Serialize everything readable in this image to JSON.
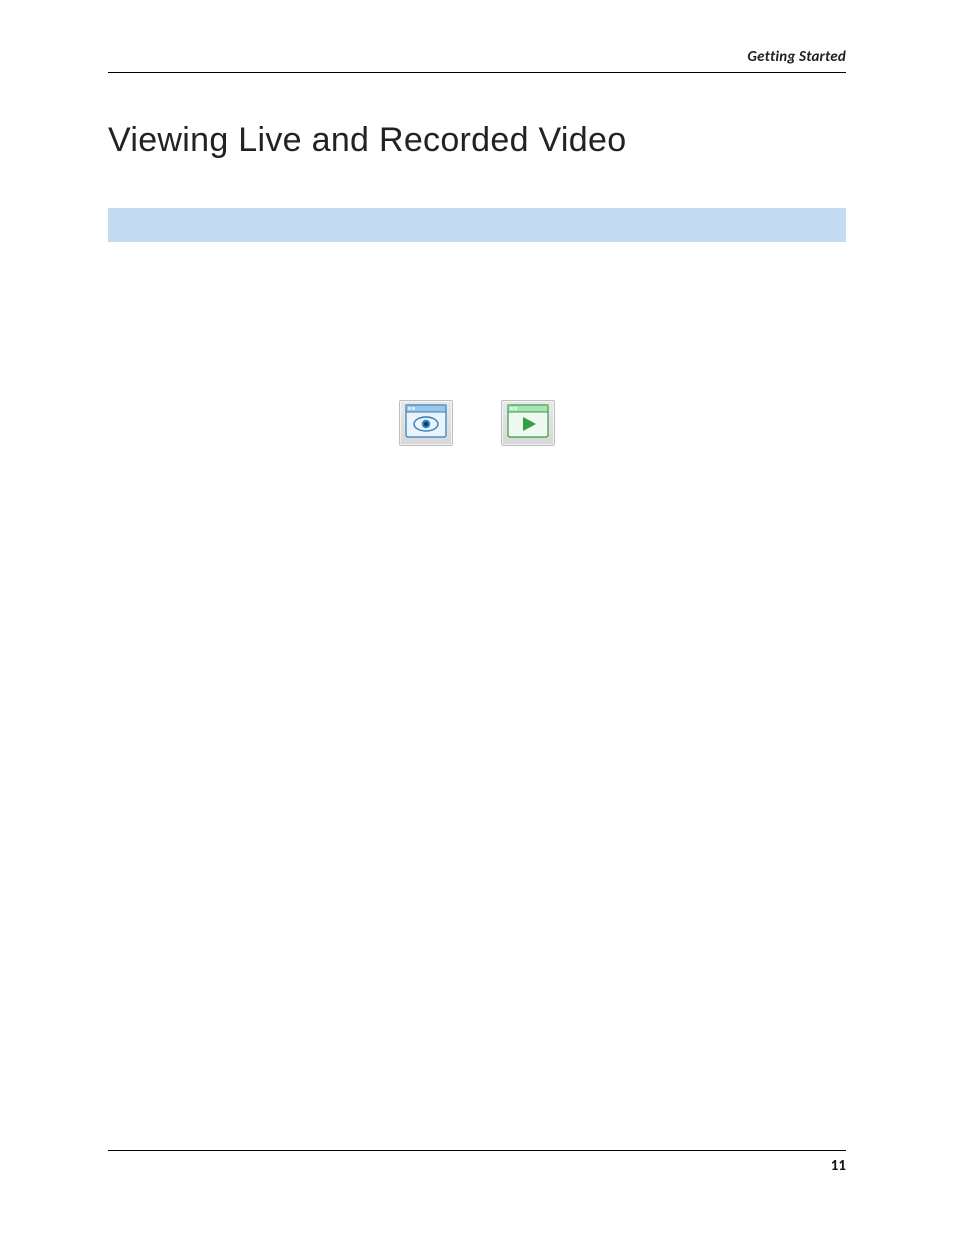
{
  "header": {
    "section": "Getting Started"
  },
  "title": "Viewing Live and Recorded Video",
  "icons": {
    "live": "live-view-icon",
    "play": "playback-icon"
  },
  "footer": {
    "page_number": "11"
  }
}
